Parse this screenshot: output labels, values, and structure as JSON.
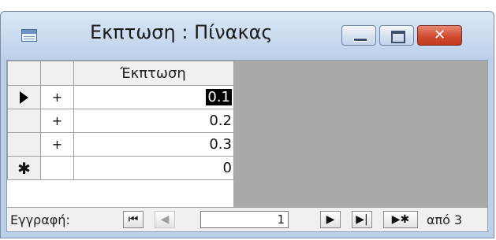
{
  "window": {
    "title": "Εκπτωση : Πίνακας",
    "controls": {
      "minimize": "–",
      "maximize": "□",
      "close": "✕"
    }
  },
  "table": {
    "column_header": "Έκπτωση",
    "rows": [
      {
        "expand": "+",
        "value": "0.1",
        "current": true
      },
      {
        "expand": "+",
        "value": "0.2"
      },
      {
        "expand": "+",
        "value": "0.3"
      }
    ],
    "new_row": {
      "marker": "✱",
      "value": "0"
    }
  },
  "navigation": {
    "record_label": "Εγγραφή:",
    "first": "⏮",
    "prev": "◀",
    "current_record": "1",
    "next": "▶",
    "last": "▶|",
    "new": "▶✱",
    "of_text": "από 3"
  }
}
